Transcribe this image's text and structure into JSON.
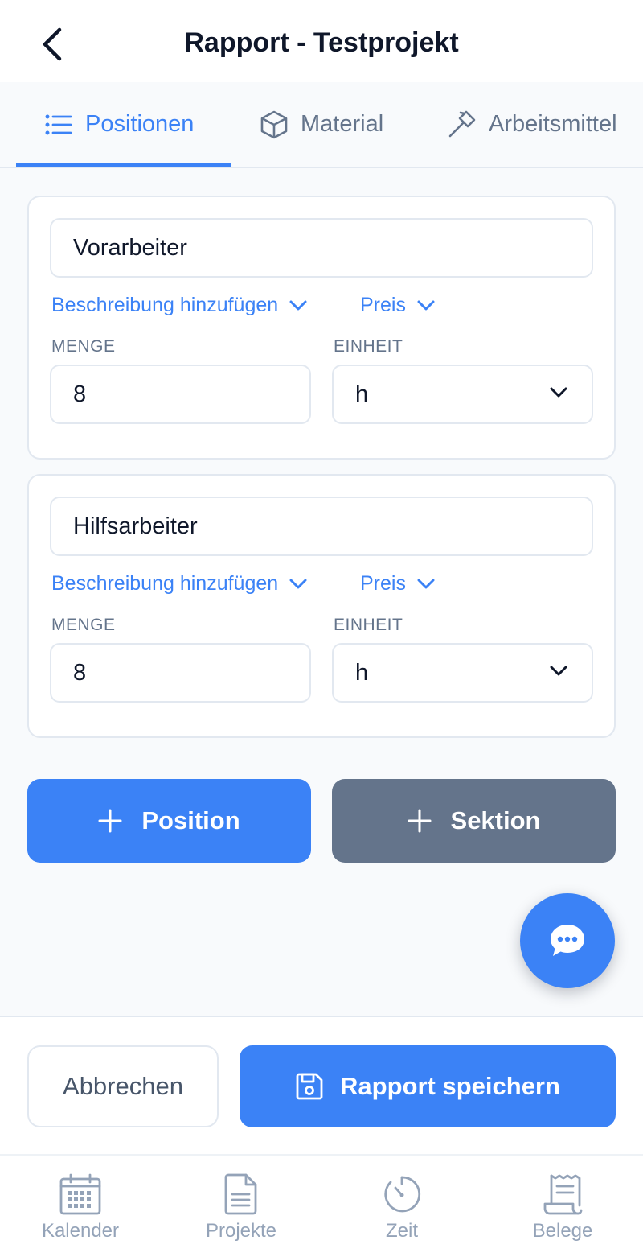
{
  "header": {
    "title": "Rapport - Testprojekt",
    "back_icon": "chevron-left-icon"
  },
  "tabs": [
    {
      "label": "Positionen",
      "icon": "list-icon",
      "active": true
    },
    {
      "label": "Material",
      "icon": "cube-icon",
      "active": false
    },
    {
      "label": "Arbeitsmittel",
      "icon": "hammer-icon",
      "active": false
    }
  ],
  "positions": [
    {
      "name": "Vorarbeiter",
      "description_link": "Beschreibung hinzufügen",
      "price_link": "Preis",
      "quantity_label": "MENGE",
      "quantity": "8",
      "unit_label": "EINHEIT",
      "unit": "h"
    },
    {
      "name": "Hilfsarbeiter",
      "description_link": "Beschreibung hinzufügen",
      "price_link": "Preis",
      "quantity_label": "MENGE",
      "quantity": "8",
      "unit_label": "EINHEIT",
      "unit": "h"
    }
  ],
  "add_buttons": {
    "position_label": "Position",
    "section_label": "Sektion"
  },
  "chat": {
    "icon": "chat-bubble-icon"
  },
  "actions": {
    "cancel_label": "Abbrechen",
    "save_label": "Rapport speichern",
    "save_icon": "save-icon"
  },
  "nav": [
    {
      "label": "Kalender",
      "icon": "calendar-icon"
    },
    {
      "label": "Projekte",
      "icon": "document-icon"
    },
    {
      "label": "Zeit",
      "icon": "timer-icon"
    },
    {
      "label": "Belege",
      "icon": "receipt-icon"
    }
  ],
  "colors": {
    "primary": "#3b82f6",
    "secondary": "#64748b",
    "background": "#f8fafc",
    "muted": "#94a3b8",
    "text": "#0f172a"
  }
}
